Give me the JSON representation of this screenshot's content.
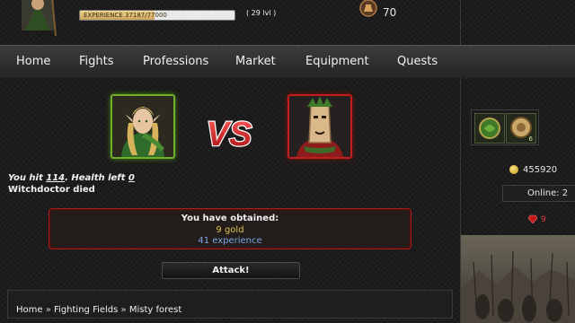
{
  "header": {
    "experience_label": "EXPERIENCE 37187/77000",
    "experience_progress": 0.483,
    "level_label": "( 29 lvl )",
    "top_counter": "70"
  },
  "nav": {
    "items": [
      "Home",
      "Fights",
      "Professions",
      "Market",
      "Equipment",
      "Quests"
    ]
  },
  "battle": {
    "vs_label": "VS",
    "log_hit_prefix": "You hit ",
    "log_hit_value": "114",
    "log_health_prefix": ". Health left ",
    "log_health_value": "0",
    "log_died": "Witchdoctor died"
  },
  "reward": {
    "title": "You have obtained:",
    "gold": "9 gold",
    "experience": "41 experience"
  },
  "attack_button_label": "Attack!",
  "breadcrumb": [
    "Home",
    "Fighting Fields",
    "Misty forest"
  ],
  "breadcrumb_separator": " » ",
  "sidebar": {
    "item_count": "6",
    "gold_amount": "455920",
    "online_label": "Online: 2",
    "gem_count": "9"
  },
  "colors": {
    "player_frame": "#6fb02b",
    "enemy_frame": "#c11d1d",
    "gold_text": "#e2c14a",
    "exp_text": "#7aa5e6"
  },
  "icons": {
    "item_1": "green-armor-icon",
    "item_2": "shield-icon",
    "gold": "gold-coin-icon",
    "gem": "ruby-gem-icon",
    "top": "potion-badge-icon"
  }
}
